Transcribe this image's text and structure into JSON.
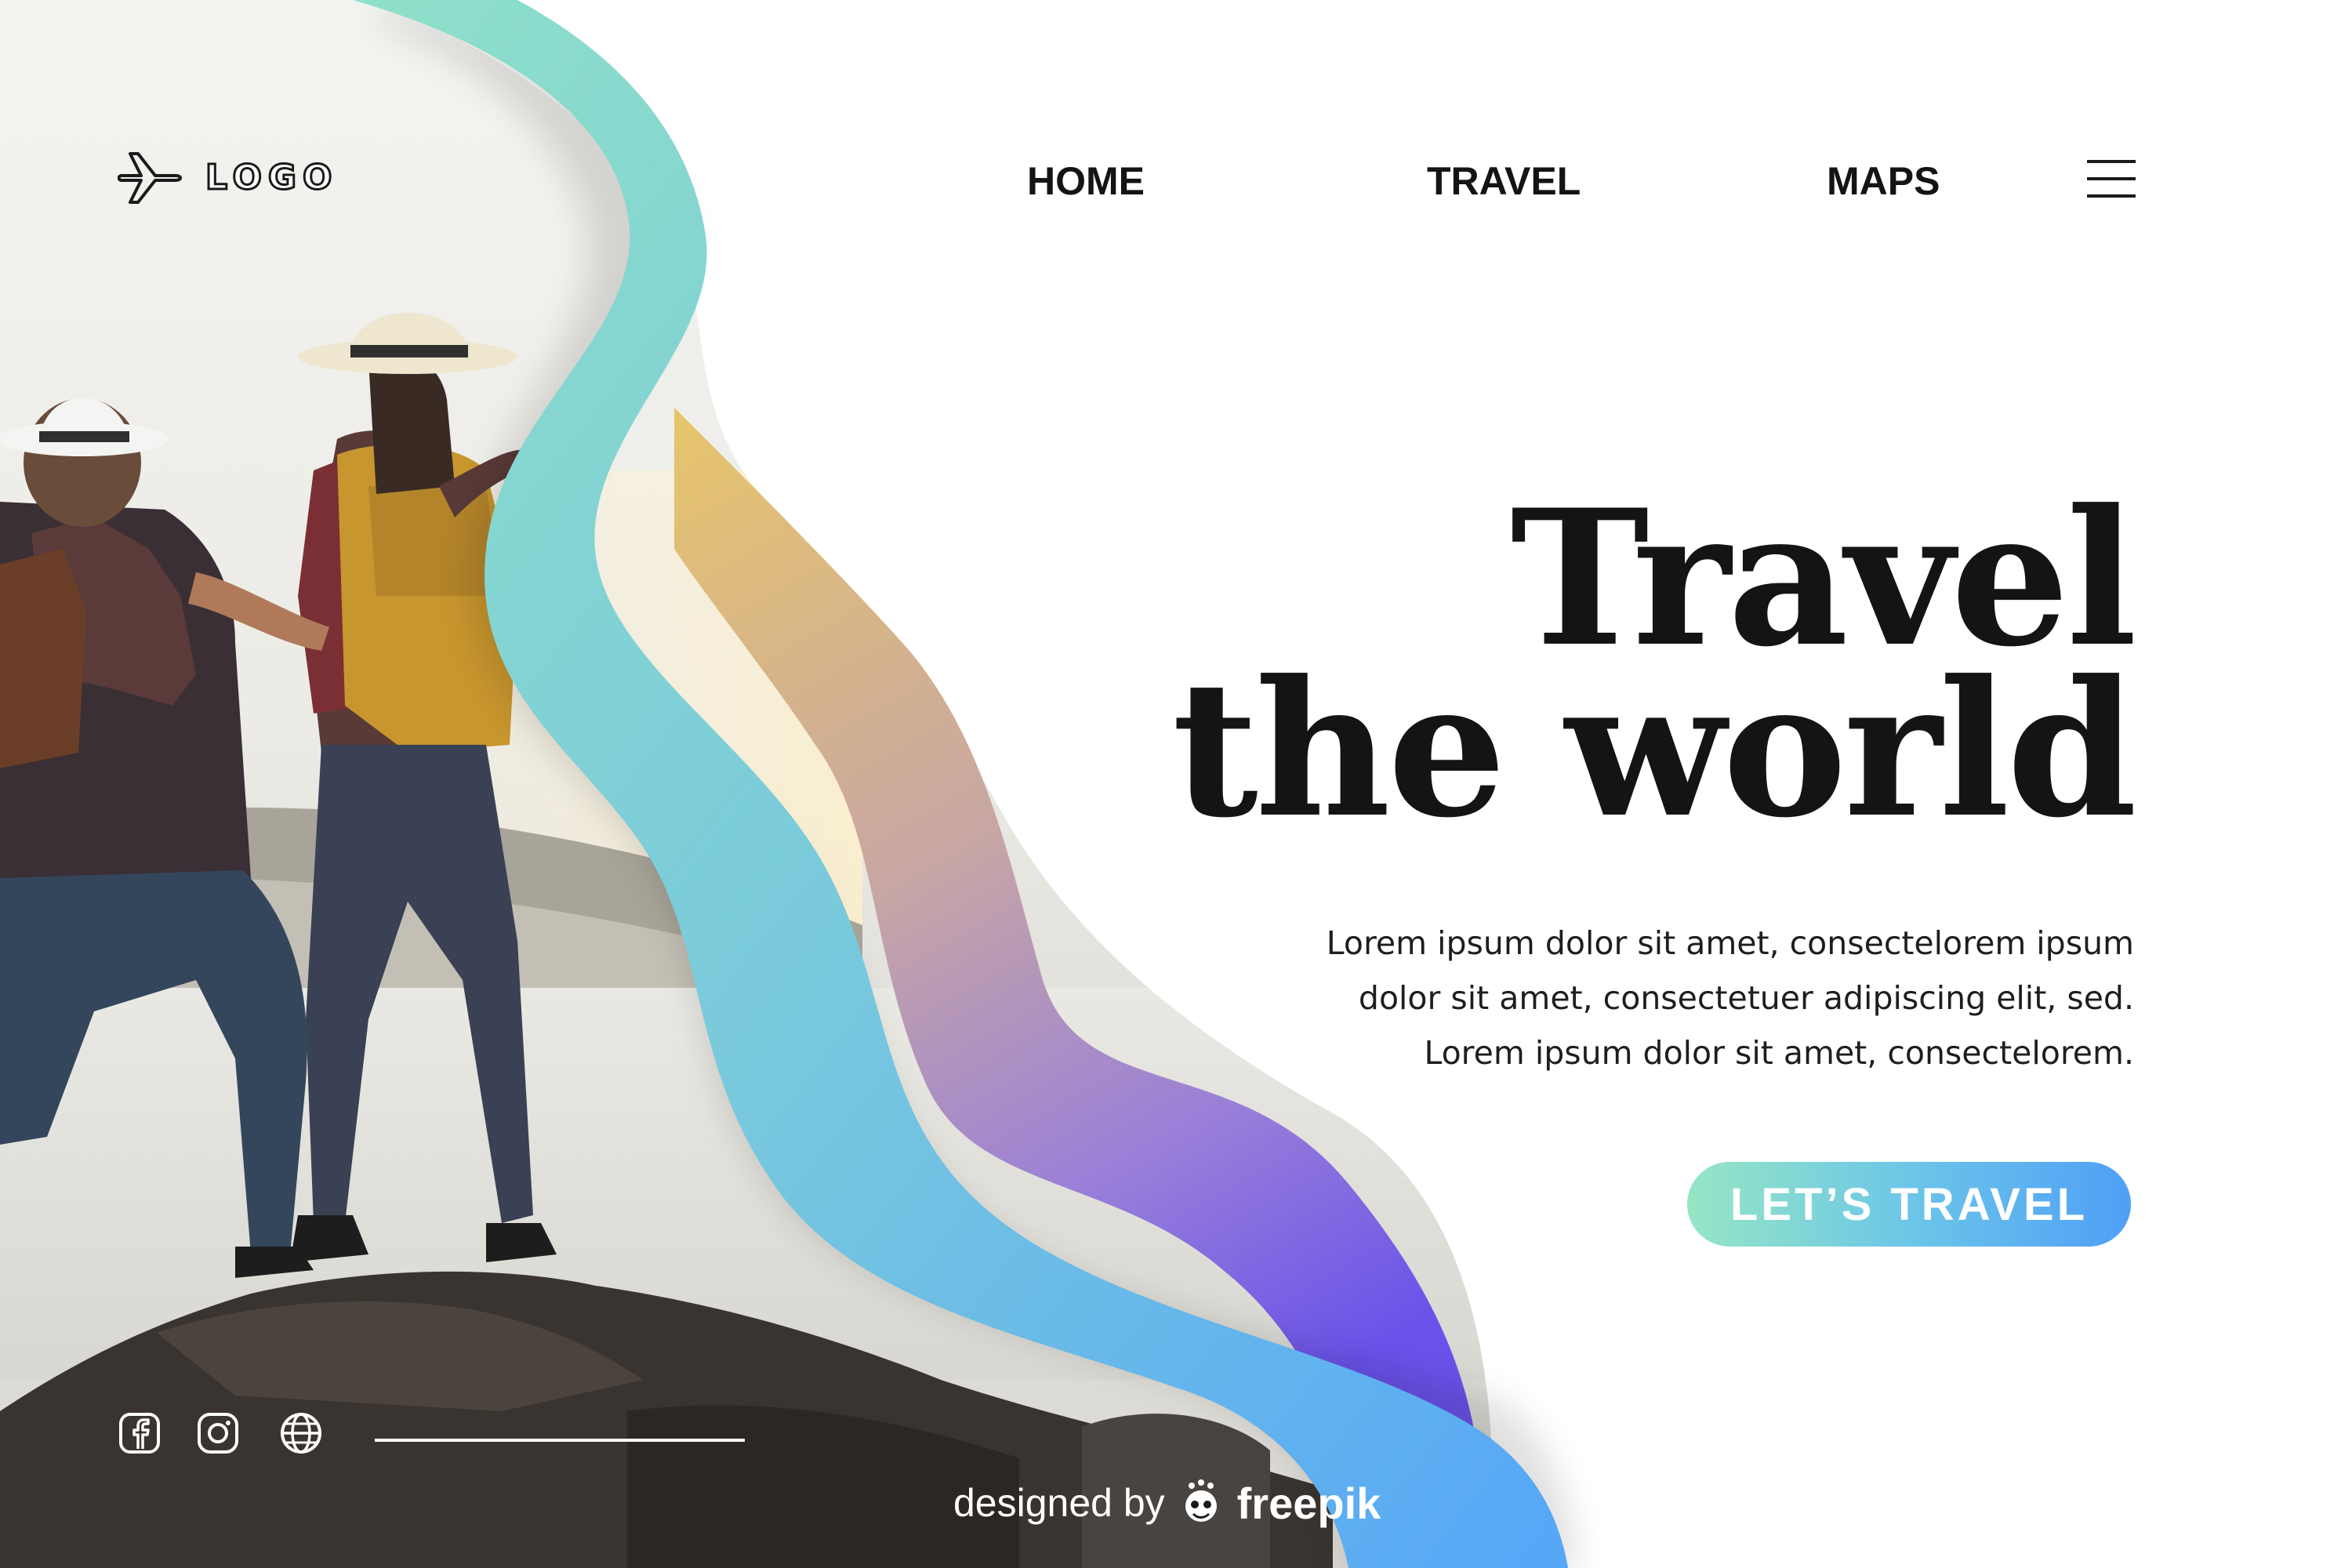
{
  "brand": {
    "logo_text": "LOGO",
    "logo_icon": "airplane-icon"
  },
  "nav": {
    "items": [
      {
        "label": "HOME"
      },
      {
        "label": "TRAVEL"
      },
      {
        "label": "MAPS"
      }
    ],
    "menu_icon": "hamburger-menu-icon"
  },
  "hero": {
    "title_line1": "Travel",
    "title_line2": "the world",
    "description": [
      "Lorem ipsum dolor sit amet, consectelorem ipsum",
      "dolor sit amet, consectetuer adipiscing elit, sed.",
      "Lorem ipsum dolor sit amet, consectelorem."
    ],
    "cta_label": "LET’S TRAVEL"
  },
  "social": {
    "icons": [
      "facebook-icon",
      "instagram-icon",
      "globe-icon"
    ]
  },
  "credit": {
    "prefix": "designed by",
    "brand": "freepik"
  },
  "colors": {
    "text_dark": "#141414",
    "wave_teal": "#8ee0c8",
    "wave_blue": "#55a6f7",
    "wave_gold": "#e6c16e",
    "wave_purple": "#7a5ae6",
    "cta_start": "#96e6c4",
    "cta_end": "#4f9ff6"
  }
}
